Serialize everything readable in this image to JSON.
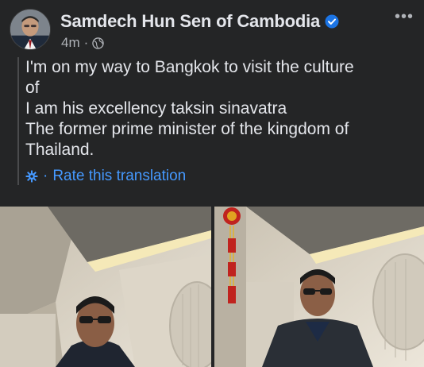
{
  "post": {
    "author": "Samdech Hun Sen of Cambodia",
    "time": "4m",
    "separator": "·",
    "more_label": "•••",
    "translated_text": "I'm on my way to Bangkok to visit the culture\nof\nI am his excellency taksin sinavatra\nThe former prime minister of the kingdom of\nThailand.",
    "rate_separator": "·",
    "rate_label": "Rate this translation"
  },
  "icons": {
    "verified": "verified-badge-icon",
    "audience": "globe-icon",
    "rate": "gear-icon",
    "more": "more-options-icon"
  },
  "colors": {
    "background": "#242526",
    "text": "#e4e6eb",
    "secondary_text": "#b0b3b8",
    "link": "#4599ff",
    "verified": "#1b74e4"
  }
}
